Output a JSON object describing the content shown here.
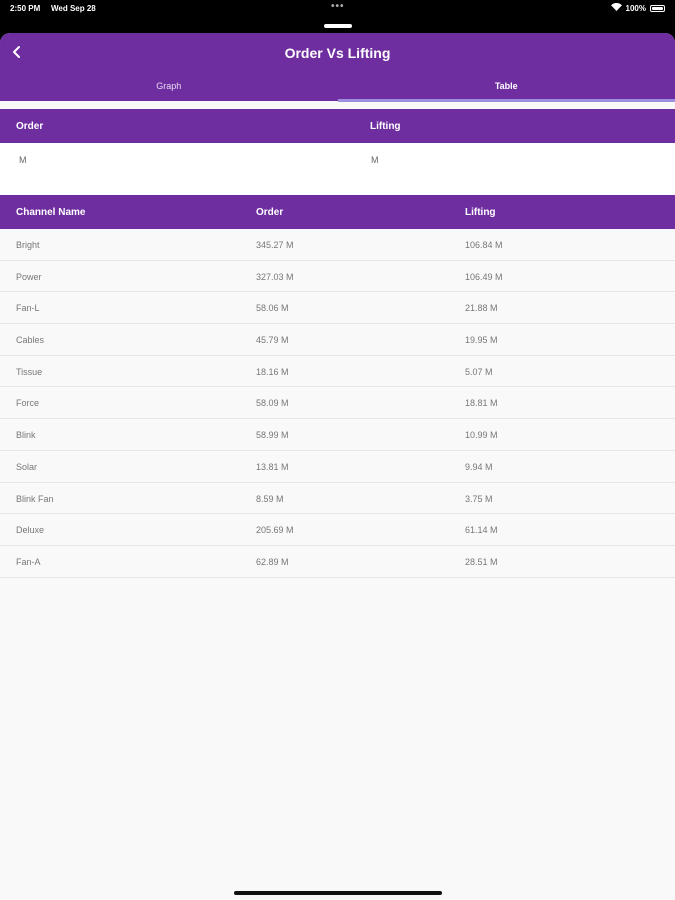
{
  "status_bar": {
    "time": "2:50 PM",
    "date": "Wed Sep 28",
    "more": "•••",
    "battery": "100%"
  },
  "header": {
    "title": "Order Vs Lifting",
    "tabs": [
      {
        "label": "Graph",
        "active": false
      },
      {
        "label": "Table",
        "active": true
      }
    ]
  },
  "summary": {
    "headers": [
      "Order",
      "Lifting"
    ],
    "values": [
      "M",
      "M"
    ]
  },
  "table": {
    "headers": [
      "Channel Name",
      "Order",
      "Lifting"
    ],
    "rows": [
      [
        "Bright",
        "345.27 M",
        "106.84 M"
      ],
      [
        "Power",
        "327.03 M",
        "106.49 M"
      ],
      [
        "Fan-L",
        "58.06 M",
        "21.88 M"
      ],
      [
        "Cables",
        "45.79 M",
        "19.95 M"
      ],
      [
        "Tissue",
        "18.16 M",
        "5.07 M"
      ],
      [
        "Force",
        "58.09 M",
        "18.81 M"
      ],
      [
        "Blink",
        "58.99 M",
        "10.99 M"
      ],
      [
        "Solar",
        "13.81 M",
        "9.94 M"
      ],
      [
        "Blink Fan",
        "8.59 M",
        "3.75 M"
      ],
      [
        "Deluxe",
        "205.69 M",
        "61.14 M"
      ],
      [
        "Fan-A",
        "62.89 M",
        "28.51 M"
      ]
    ]
  },
  "colors": {
    "header_purple": "#6f2ea0",
    "tab_indicator": "#9c8fe0"
  }
}
